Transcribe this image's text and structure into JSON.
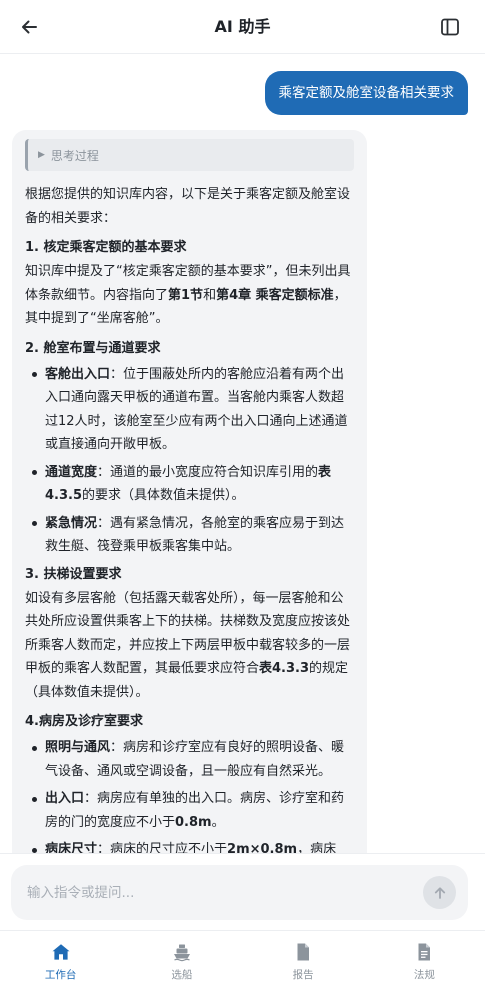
{
  "header": {
    "back_icon": "arrow-left-icon",
    "title": "AI 助手",
    "sidebar_icon": "sidebar-panel-icon"
  },
  "user_message": "乘客定额及舱室设备相关要求",
  "ai_message": {
    "thinking_label": "思考过程",
    "intro": "根据您提供的知识库内容，以下是关于乘客定额及舱室设备的相关要求：",
    "s1": {
      "heading": "1. 核定乘客定额的基本要求",
      "t1": "知识库中提及了“核定乘客定额的基本要求”，但未列出具体条款细节。内容指向了",
      "b1": "第1节",
      "t2": "和",
      "b2": "第4章 乘客定额标准",
      "t3": "，其中提到了“坐席客舱”。"
    },
    "s2": {
      "heading": "2. 舱室布置与通道要求",
      "items": [
        {
          "label": "客舱出入口",
          "text": "：位于围蔽处所内的客舱应沿着有两个出入口通向露天甲板的通道布置。当客舱内乘客人数超过12人时，该舱室至少应有两个出入口通向上述通道或直接通向开敞甲板。"
        },
        {
          "label": "通道宽度",
          "text": "：通道的最小宽度应符合知识库引用的",
          "b": "表4.3.5",
          "text2": "的要求（具体数值未提供）。"
        },
        {
          "label": "紧急情况",
          "text": "：遇有紧急情况，各舱室的乘客应易于到达救生艇、筏登乘甲板乘客集中站。"
        }
      ]
    },
    "s3": {
      "heading": "3. 扶梯设置要求",
      "t1": "如设有多层客舱（包括露天载客处所），每一层客舱和公共处所应设置供乘客上下的扶梯。扶梯数及宽度应按该处所乘客人数而定，并应按上下两层甲板中载客较多的一层甲板的乘客人数配置，其最低要求应符合",
      "b1": "表4.3.3",
      "t2": "的规定（具体数值未提供）。"
    },
    "s4": {
      "heading": "4.病房及诊疗室要求",
      "items": [
        {
          "label": "照明与通风",
          "text": "：病房和诊疗室应有良好的照明设备、暖气设备、通风或空调设备，且一般应有自然采光。"
        },
        {
          "label": "出入口",
          "text": "：病房应有单独的出入口。病房、诊疗室和药房的门的宽度应不小于",
          "b": "0.8m",
          "text2": "。"
        },
        {
          "label": "病床尺寸",
          "text": "：病床的尺寸应不小于",
          "b": "2m×0.8m",
          "text2": "，病床"
        }
      ]
    }
  },
  "input": {
    "placeholder": "输入指令或提问...",
    "send_icon": "arrow-up-icon"
  },
  "nav": [
    {
      "label": "工作台",
      "icon": "home-icon",
      "active": true
    },
    {
      "label": "选船",
      "icon": "ship-icon",
      "active": false
    },
    {
      "label": "报告",
      "icon": "document-icon",
      "active": false
    },
    {
      "label": "法规",
      "icon": "regulation-doc-icon",
      "active": false
    }
  ],
  "colors": {
    "accent": "#1f6bb5",
    "user_bubble": "#1f6bb5",
    "ai_bubble": "#f3f4f6",
    "inactive_nav": "#8c949c"
  }
}
